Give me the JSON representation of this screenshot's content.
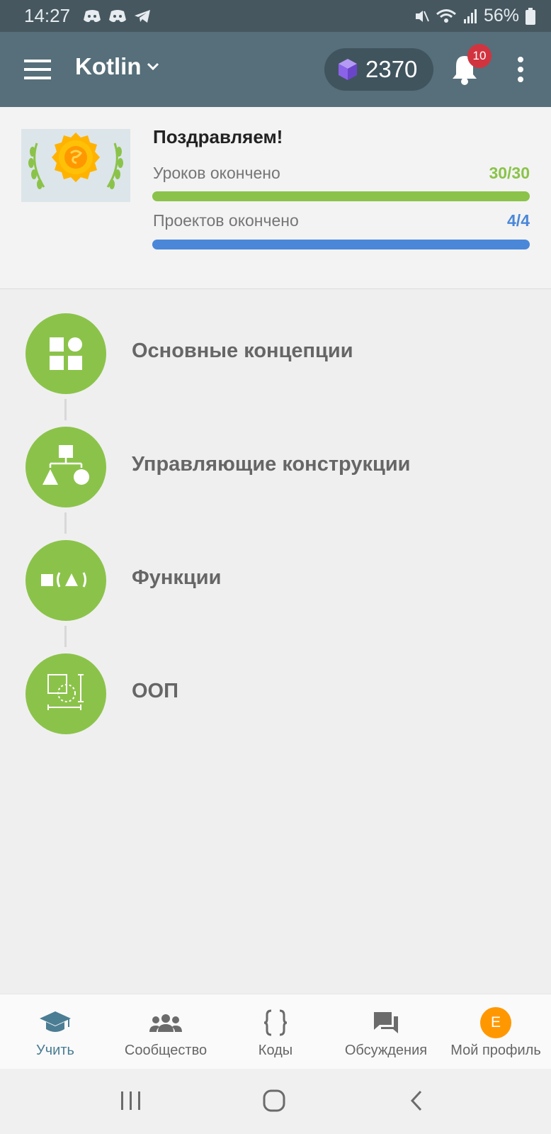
{
  "status_bar": {
    "time": "14:27",
    "battery": "56%",
    "left_icons": [
      "discord-icon",
      "discord-icon",
      "telegram-icon"
    ],
    "right_icons": [
      "mute-icon",
      "wifi-icon",
      "signal-icon",
      "battery-icon"
    ]
  },
  "app_bar": {
    "title": "Kotlin",
    "gems": "2370",
    "notifications": "10"
  },
  "progress": {
    "congrats": "Поздравляем!",
    "lessons_label": "Уроков окончено",
    "lessons_value": "30/30",
    "lessons_fraction": 1.0,
    "projects_label": "Проектов окончено",
    "projects_value": "4/4",
    "projects_fraction": 1.0
  },
  "colors": {
    "app_bar": "#566f7a",
    "green": "#8bc34a",
    "blue": "#4a87d8",
    "lessons_value": "#8bc34a",
    "projects_value": "#4a87d8"
  },
  "modules": [
    {
      "label": "Основные концепции",
      "icon": "shapes-icon"
    },
    {
      "label": "Управляющие конструкции",
      "icon": "hierarchy-icon"
    },
    {
      "label": "Функции",
      "icon": "function-icon"
    },
    {
      "label": "ООП",
      "icon": "oop-icon"
    }
  ],
  "bottom_nav": [
    {
      "label": "Учить",
      "icon": "graduation-cap-icon",
      "active": true
    },
    {
      "label": "Сообщество",
      "icon": "people-icon",
      "active": false
    },
    {
      "label": "Коды",
      "icon": "braces-icon",
      "active": false
    },
    {
      "label": "Обсуждения",
      "icon": "chat-icon",
      "active": false
    },
    {
      "label": "Мой профиль",
      "icon": "avatar-icon",
      "active": false,
      "avatar_letter": "E"
    }
  ]
}
